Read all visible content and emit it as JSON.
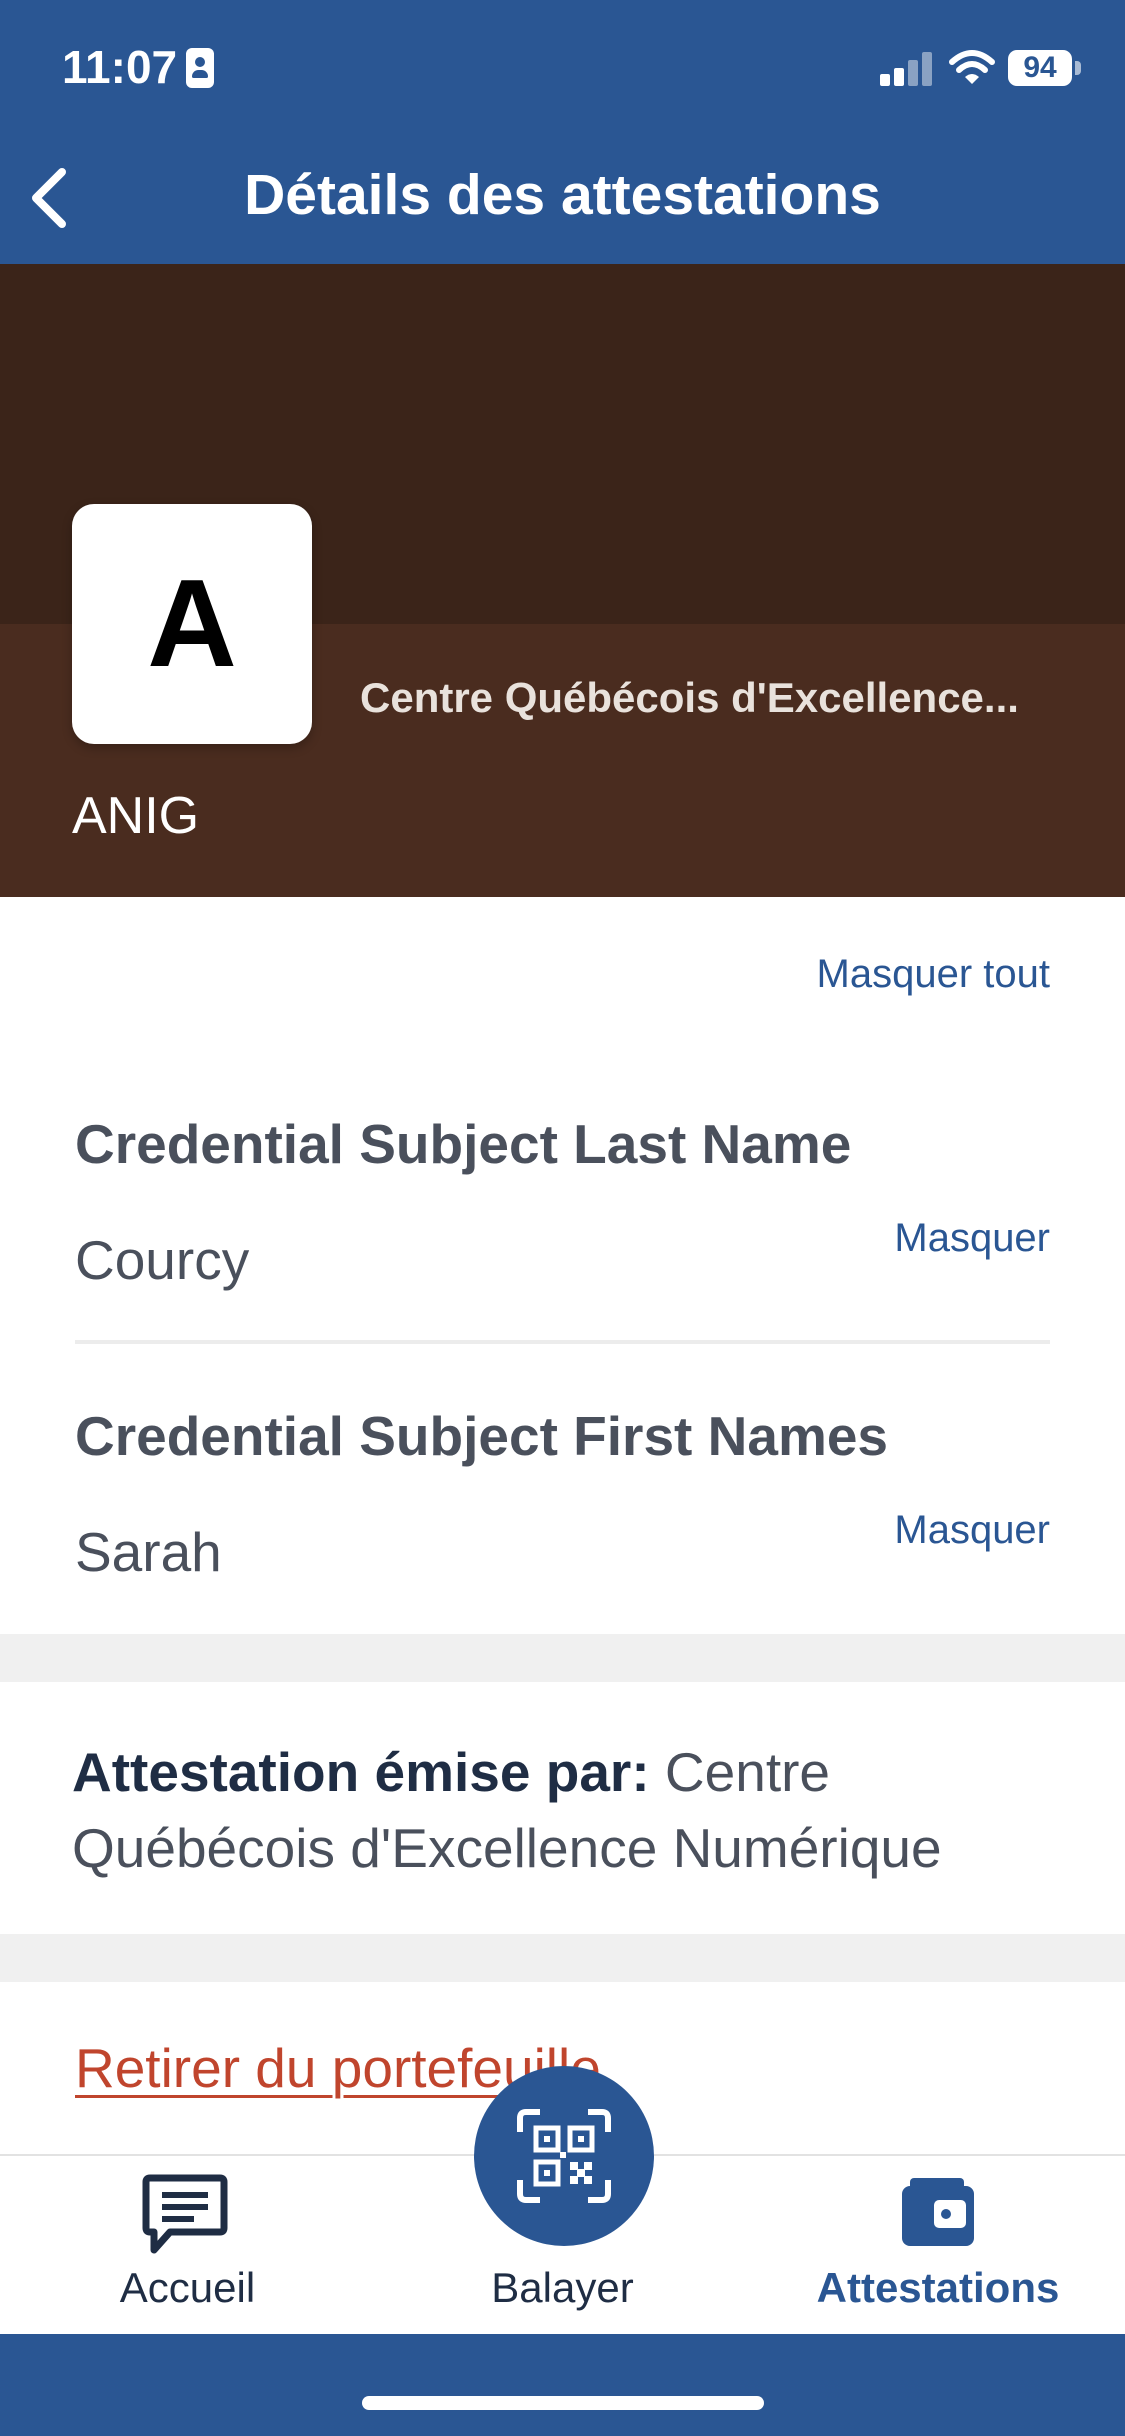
{
  "status_bar": {
    "time": "11:07",
    "battery": "94"
  },
  "header": {
    "title": "Détails des attestations"
  },
  "credential": {
    "logo_letter": "A",
    "issuer_short": "Centre Québécois d'Excellence...",
    "name": "ANIG",
    "banner_colors": {
      "top": "#3b2419",
      "bottom": "#4a2c1f"
    }
  },
  "attributes": {
    "hide_all": "Masquer tout",
    "items": [
      {
        "label": "Credential Subject Last Name",
        "value": "Courcy",
        "hide": "Masquer"
      },
      {
        "label": "Credential Subject First Names",
        "value": "Sarah",
        "hide": "Masquer"
      }
    ]
  },
  "issued_by": {
    "label": "Attestation émise par:",
    "value": "Centre Québécois d'Excellence Numérique"
  },
  "remove_link": "Retirer du portefeuille",
  "tabbar": {
    "items": [
      {
        "label": "Accueil",
        "icon": "message-icon",
        "active": false
      },
      {
        "label": "Balayer",
        "icon": "qr-scan-icon",
        "active": false
      },
      {
        "label": "Attestations",
        "icon": "wallet-icon",
        "active": true
      }
    ]
  },
  "colors": {
    "primary": "#2a5693",
    "danger": "#c0452d",
    "text": "#4a505c"
  }
}
